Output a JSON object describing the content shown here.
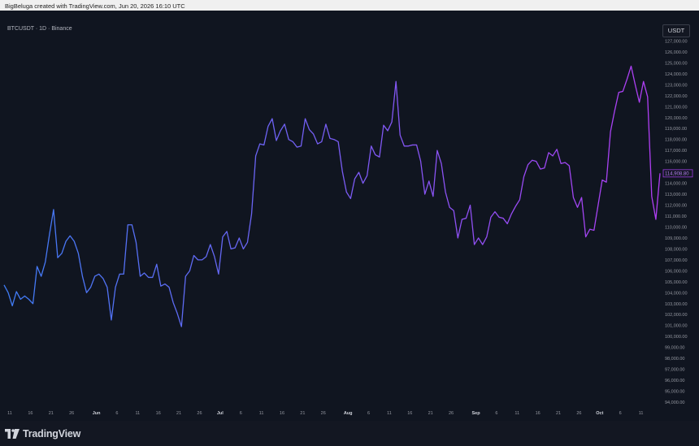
{
  "header": {
    "text": "BigBeluga created with TradingView.com, Jun 20, 2026 16:10 UTC"
  },
  "chart": {
    "symbol": "BTCUSDT · 1D · Binance",
    "currency": "USDT",
    "line_color_start": "#3f7cf5",
    "line_color_end": "#b03df2",
    "last_price_label": "114,908.80"
  },
  "footer": {
    "brand": "TradingView"
  },
  "chart_data": {
    "type": "line",
    "title": "",
    "xlabel": "",
    "ylabel": "",
    "ylim": [
      94000,
      128000
    ],
    "y_ticks": [
      128000,
      127000,
      126000,
      125000,
      124000,
      123000,
      122000,
      121000,
      120000,
      119000,
      118000,
      117000,
      116000,
      115000,
      114000,
      113000,
      112000,
      111000,
      110000,
      109000,
      108000,
      107000,
      106000,
      105000,
      104000,
      103000,
      102000,
      101000,
      100000,
      99000,
      98000,
      97000,
      96000,
      95000,
      94000
    ],
    "y_tick_labels": [
      "128,000.00",
      "127,000.00",
      "126,000.00",
      "125,000.00",
      "124,000.00",
      "123,000.00",
      "122,000.00",
      "121,000.00",
      "120,000.00",
      "119,000.00",
      "118,000.00",
      "117,000.00",
      "116,000.00",
      "115,000.00",
      "114,000.00",
      "113,000.00",
      "112,000.00",
      "111,000.00",
      "110,000.00",
      "109,000.00",
      "108,000.00",
      "107,000.00",
      "106,000.00",
      "105,000.00",
      "104,000.00",
      "103,000.00",
      "102,000.00",
      "101,000.00",
      "100,000.00",
      "99,000.00",
      "98,000.00",
      "97,000.00",
      "96,000.00",
      "95,000.00",
      "94,000.00"
    ],
    "x_ticks": [
      {
        "label": "11",
        "day": 0
      },
      {
        "label": "16",
        "day": 5
      },
      {
        "label": "21",
        "day": 10
      },
      {
        "label": "26",
        "day": 15
      },
      {
        "label": "Jun",
        "day": 21
      },
      {
        "label": "6",
        "day": 26
      },
      {
        "label": "11",
        "day": 31
      },
      {
        "label": "16",
        "day": 36
      },
      {
        "label": "21",
        "day": 41
      },
      {
        "label": "26",
        "day": 46
      },
      {
        "label": "Jul",
        "day": 51
      },
      {
        "label": "6",
        "day": 56
      },
      {
        "label": "11",
        "day": 61
      },
      {
        "label": "16",
        "day": 66
      },
      {
        "label": "21",
        "day": 71
      },
      {
        "label": "26",
        "day": 76
      },
      {
        "label": "Aug",
        "day": 82
      },
      {
        "label": "6",
        "day": 87
      },
      {
        "label": "11",
        "day": 92
      },
      {
        "label": "16",
        "day": 97
      },
      {
        "label": "21",
        "day": 102
      },
      {
        "label": "26",
        "day": 107
      },
      {
        "label": "Sep",
        "day": 113
      },
      {
        "label": "6",
        "day": 118
      },
      {
        "label": "11",
        "day": 123
      },
      {
        "label": "16",
        "day": 128
      },
      {
        "label": "21",
        "day": 133
      },
      {
        "label": "26",
        "day": 138
      },
      {
        "label": "Oct",
        "day": 143
      },
      {
        "label": "6",
        "day": 148
      },
      {
        "label": "11",
        "day": 153
      }
    ],
    "series": [
      {
        "values": [
          104700,
          104000,
          102800,
          104100,
          103400,
          103700,
          103400,
          103000,
          106400,
          105500,
          106800,
          109300,
          111600,
          107200,
          107600,
          108700,
          109200,
          108700,
          107600,
          105500,
          104000,
          104500,
          105500,
          105700,
          105300,
          104500,
          101500,
          104500,
          105700,
          105700,
          110200,
          110200,
          108600,
          105500,
          105800,
          105400,
          105400,
          106600,
          104600,
          104800,
          104500,
          103100,
          102100,
          100900,
          105500,
          106000,
          107400,
          107000,
          107000,
          107300,
          108400,
          107300,
          105700,
          109100,
          109600,
          108000,
          108100,
          109000,
          108000,
          108600,
          111200,
          116500,
          117600,
          117500,
          119200,
          119900,
          117900,
          118800,
          119400,
          118000,
          117800,
          117300,
          117400,
          119900,
          118900,
          118500,
          117600,
          117800,
          119400,
          118100,
          118000,
          117800,
          115100,
          113200,
          112600,
          114400,
          115000,
          114000,
          114700,
          117400,
          116600,
          116400,
          119300,
          118800,
          119600,
          123300,
          118400,
          117400,
          117400,
          117500,
          117500,
          116000,
          113000,
          114200,
          112800,
          117000,
          115800,
          113200,
          111800,
          111500,
          109000,
          110700,
          110800,
          112000,
          108400,
          109000,
          108400,
          109100,
          110900,
          111400,
          110900,
          110800,
          110300,
          111200,
          111900,
          112500,
          114600,
          115700,
          116100,
          116000,
          115300,
          115400,
          116800,
          116500,
          117100,
          115800,
          115900,
          115600,
          112700,
          111800,
          112700,
          109100,
          109800,
          109700,
          112000,
          114300,
          114100,
          118700,
          120600,
          122300,
          122400,
          123500,
          124700,
          123000,
          121400,
          123300,
          121900,
          112800,
          110700,
          114908
        ]
      }
    ]
  }
}
